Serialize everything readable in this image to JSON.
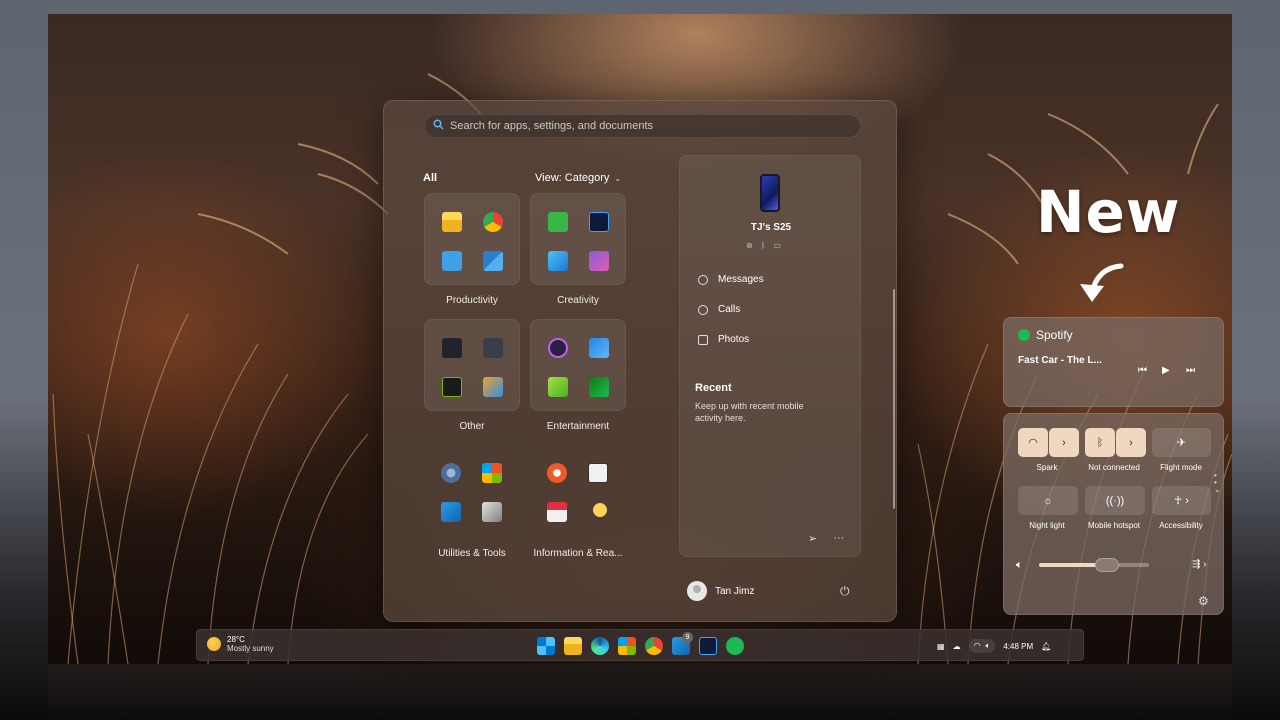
{
  "search": {
    "placeholder": "Search for apps, settings, and documents"
  },
  "start_menu": {
    "all_label": "All",
    "view_label": "View: Category",
    "groups": [
      {
        "label": "Productivity"
      },
      {
        "label": "Creativity"
      },
      {
        "label": "Other"
      },
      {
        "label": "Entertainment"
      },
      {
        "label": "Utilities & Tools"
      },
      {
        "label": "Information & Rea..."
      }
    ],
    "phone": {
      "device_name": "TJ's S25",
      "links": [
        {
          "label": "Messages",
          "icon": "message-icon"
        },
        {
          "label": "Calls",
          "icon": "phone-icon"
        },
        {
          "label": "Photos",
          "icon": "photo-icon"
        }
      ],
      "recent_title": "Recent",
      "recent_text": "Keep up with recent mobile activity here."
    },
    "user_name": "Tan Jimz"
  },
  "annotation": {
    "new_label": "New"
  },
  "spotify": {
    "app_name": "Spotify",
    "track": "Fast Car - The L...",
    "accent": "#1db954"
  },
  "quick_settings": {
    "tiles": [
      {
        "label": "Spark",
        "icon": "wifi-icon",
        "active": true
      },
      {
        "label": "Not connected",
        "icon": "bluetooth-icon",
        "active": true
      },
      {
        "label": "Flight mode",
        "icon": "airplane-icon",
        "active": false
      },
      {
        "label": "Night light",
        "icon": "brightness-icon",
        "active": false
      },
      {
        "label": "Mobile hotspot",
        "icon": "hotspot-icon",
        "active": false
      },
      {
        "label": "Accessibility",
        "icon": "accessibility-icon",
        "active": false
      }
    ],
    "volume_fraction": 0.62,
    "tile_active_color": "#f0d8c0"
  },
  "taskbar": {
    "weather_temp": "28°C",
    "weather_desc": "Mostly sunny",
    "store_badge": "9",
    "time": "4:48 PM"
  }
}
